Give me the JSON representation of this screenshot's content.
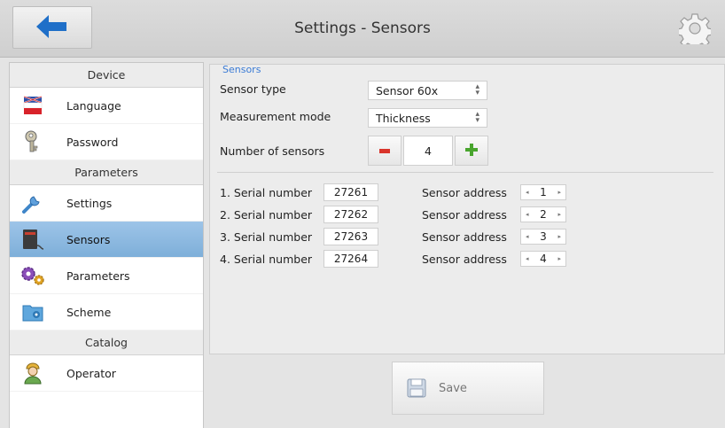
{
  "header": {
    "title": "Settings - Sensors"
  },
  "sidebar": {
    "groups": [
      {
        "label": "Device",
        "items": [
          {
            "label": "Language",
            "icon": "flag-icon"
          },
          {
            "label": "Password",
            "icon": "key-icon"
          }
        ]
      },
      {
        "label": "Parameters",
        "items": [
          {
            "label": "Settings",
            "icon": "wrench-icon"
          },
          {
            "label": "Sensors",
            "icon": "sensor-icon"
          },
          {
            "label": "Parameters",
            "icon": "gears-icon"
          },
          {
            "label": "Scheme",
            "icon": "scheme-icon"
          }
        ]
      },
      {
        "label": "Catalog",
        "items": [
          {
            "label": "Operator",
            "icon": "operator-icon"
          }
        ]
      }
    ],
    "active_item": "Sensors"
  },
  "sensors": {
    "legend": "Sensors",
    "sensor_type_label": "Sensor type",
    "sensor_type_value": "Sensor 60x",
    "measurement_mode_label": "Measurement mode",
    "measurement_mode_value": "Thickness",
    "number_label": "Number of sensors",
    "number_value": "4",
    "rows": [
      {
        "serial_label": "1. Serial number",
        "serial": "27261",
        "addr_label": "Sensor address",
        "addr": "1"
      },
      {
        "serial_label": "2. Serial number",
        "serial": "27262",
        "addr_label": "Sensor address",
        "addr": "2"
      },
      {
        "serial_label": "3. Serial number",
        "serial": "27263",
        "addr_label": "Sensor address",
        "addr": "3"
      },
      {
        "serial_label": "4. Serial number",
        "serial": "27264",
        "addr_label": "Sensor address",
        "addr": "4"
      }
    ]
  },
  "save": {
    "label": "Save"
  },
  "colors": {
    "accent": "#3a7bd5",
    "active_bg": "#8fbbe3",
    "plus": "#49a52e",
    "minus": "#d9342b"
  }
}
